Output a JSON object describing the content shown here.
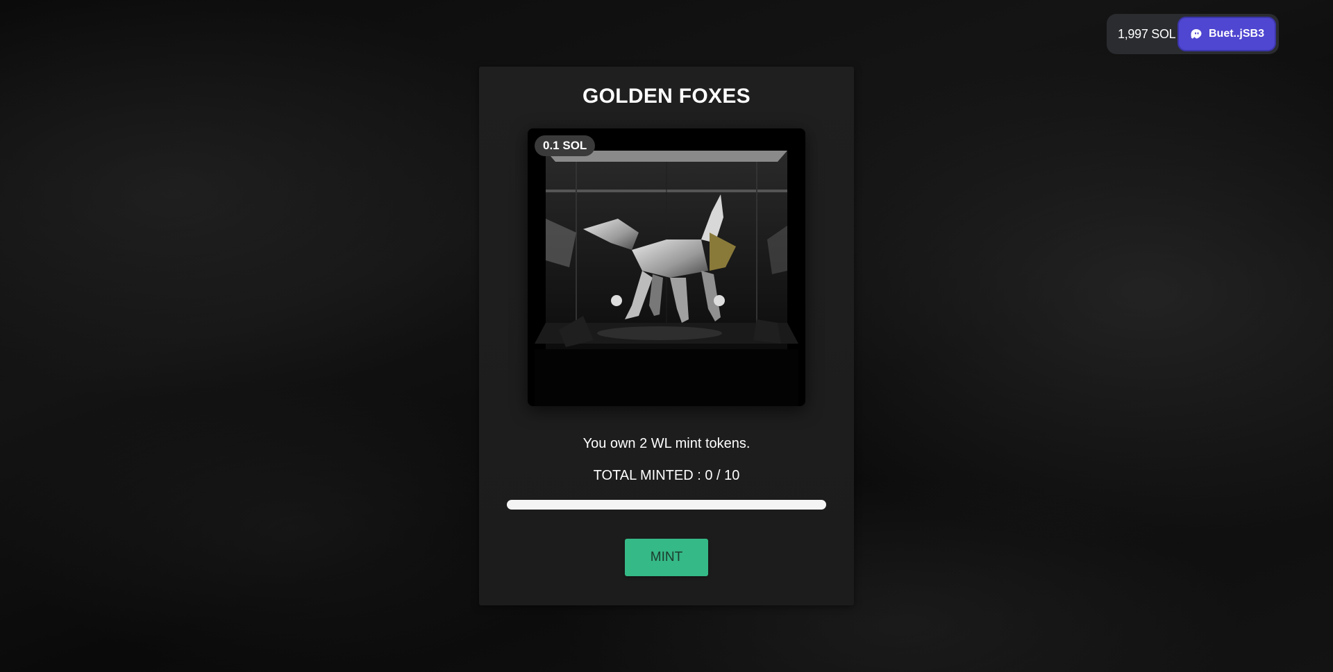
{
  "wallet": {
    "balance": "1,997 SOL",
    "address": "Buet..jSB3",
    "icon": "phantom-ghost-icon",
    "button_color": "#4f46d1"
  },
  "card": {
    "title": "GOLDEN FOXES",
    "price_badge": "0.1 SOL",
    "image_description_icon": "nft-fox-sculpture-image",
    "wl_message": "You own 2 WL mint tokens.",
    "total_minted_text": "TOTAL MINTED : 0 / 10",
    "progress": {
      "minted": 0,
      "total": 10,
      "fill_color": "#36b583",
      "track_color": "#f4f4f4"
    },
    "mint_label": "MINT",
    "mint_color": "#35b986"
  }
}
